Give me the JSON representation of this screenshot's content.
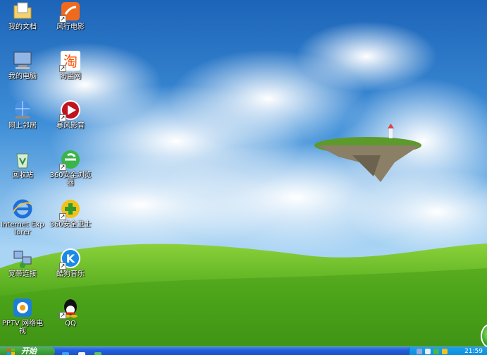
{
  "desktop_icons": [
    {
      "label": "我的文档",
      "icon": "my-documents-icon"
    },
    {
      "label": "风行电影",
      "icon": "funshion-icon"
    },
    {
      "label": "我的电脑",
      "icon": "my-computer-icon"
    },
    {
      "label": "淘宝网",
      "icon": "taobao-icon"
    },
    {
      "label": "网上邻居",
      "icon": "network-places-icon"
    },
    {
      "label": "暴风影音",
      "icon": "baofeng-icon"
    },
    {
      "label": "回收站",
      "icon": "recycle-bin-icon"
    },
    {
      "label": "360安全浏览器",
      "icon": "360-browser-icon"
    },
    {
      "label": "Internet Explorer",
      "icon": "internet-explorer-icon"
    },
    {
      "label": "360安全卫士",
      "icon": "360-safe-icon"
    },
    {
      "label": "宽带连接",
      "icon": "broadband-connection-icon"
    },
    {
      "label": "酷狗音乐",
      "icon": "kugou-icon"
    },
    {
      "label": "PPTV 网络电视",
      "icon": "pptv-icon"
    },
    {
      "label": "QQ",
      "icon": "qq-icon"
    }
  ],
  "taskbar": {
    "start_label": "开始",
    "clock": "21:59",
    "quicklaunch": [
      "ie-icon",
      "media-icon",
      "360-icon"
    ],
    "tray": [
      "network-icon",
      "volume-icon",
      "security-icon",
      "qq-tray-icon"
    ]
  },
  "colors": {
    "taskbar": "#245edb",
    "start": "#2f8f2b",
    "sky": "#3f8fd8",
    "grass": "#5aae1e"
  }
}
